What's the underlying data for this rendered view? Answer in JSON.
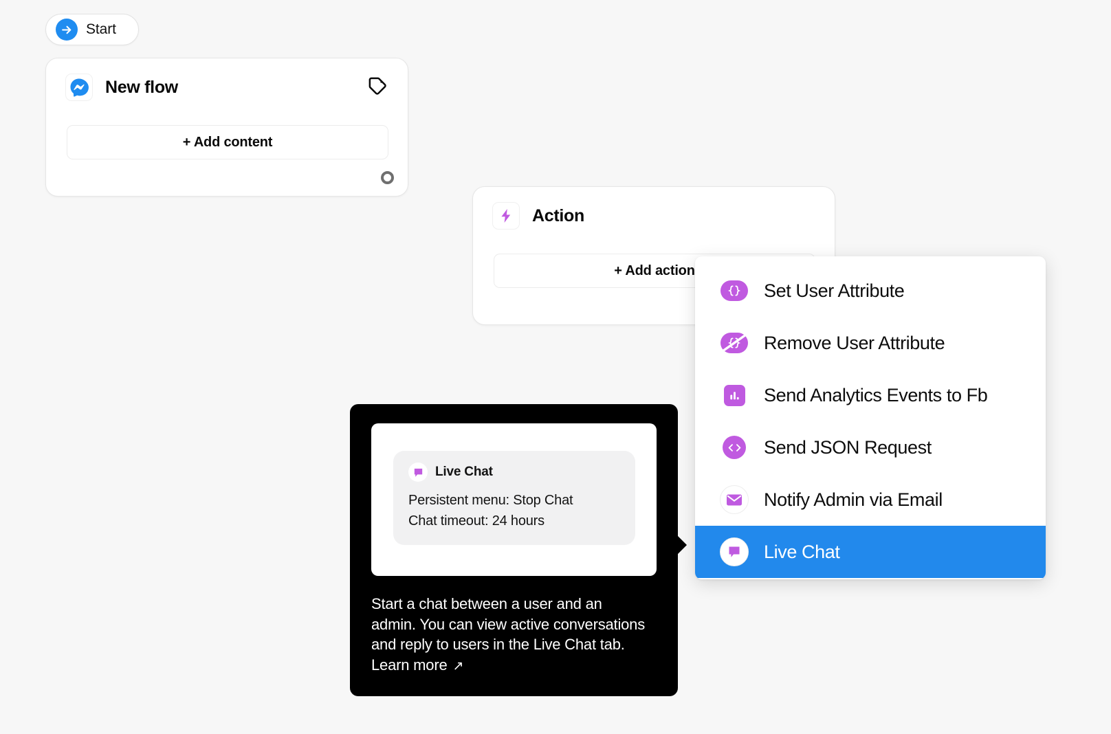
{
  "colors": {
    "canvas_bg": "#f7f7f7",
    "accent_blue": "#1f8cf0",
    "selected_blue": "#2289ec",
    "action_purple": "#c05ae0",
    "tooltip_black": "#000000"
  },
  "start_node": {
    "label": "Start",
    "icon": "arrow-right-circle-icon"
  },
  "flow_card": {
    "icon": "messenger-icon",
    "title": "New flow",
    "tag_icon": "tag-icon",
    "add_button_label": "+ Add content",
    "connector_icon": "connector-ring-icon"
  },
  "action_card": {
    "icon": "lightning-bolt-icon",
    "title": "Action",
    "add_button_label": "+ Add action"
  },
  "action_menu": {
    "items": [
      {
        "label": "Set User Attribute",
        "icon": "braces-icon",
        "selected": false
      },
      {
        "label": "Remove User Attribute",
        "icon": "braces-slash-icon",
        "selected": false
      },
      {
        "label": "Send Analytics Events to Fb",
        "icon": "bar-chart-icon",
        "selected": false
      },
      {
        "label": "Send JSON Request",
        "icon": "code-brackets-icon",
        "selected": false
      },
      {
        "label": "Notify Admin via Email",
        "icon": "envelope-icon",
        "selected": false
      },
      {
        "label": "Live Chat",
        "icon": "chat-bubble-icon",
        "selected": true
      }
    ]
  },
  "tooltip": {
    "preview": {
      "icon": "chat-bubble-icon",
      "title": "Live Chat",
      "line1": "Persistent menu: Stop Chat",
      "line2": "Chat timeout: 24 hours"
    },
    "description": "Start a chat between a user and an admin. You can view active conversations and reply to users in the Live Chat tab. Learn more",
    "learn_more_arrow": "↗"
  }
}
